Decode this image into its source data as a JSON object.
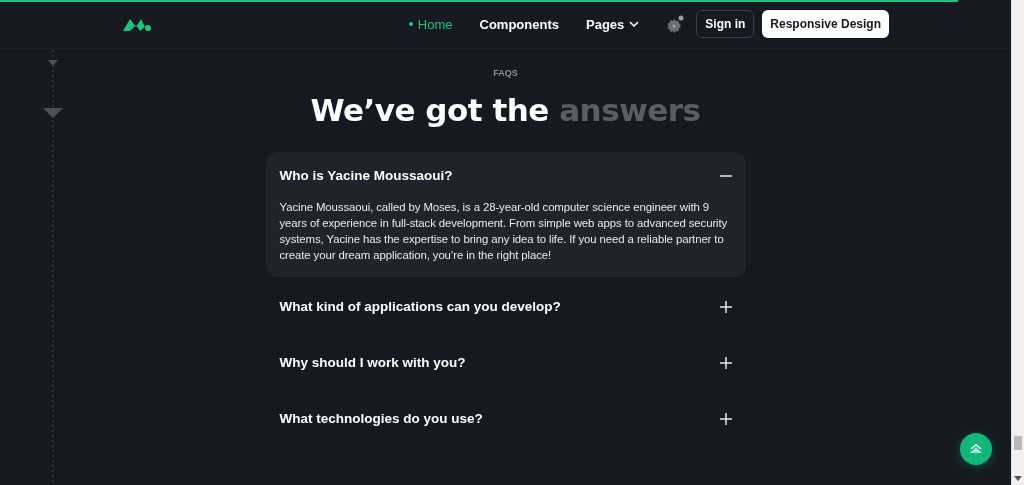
{
  "nav": {
    "links": [
      {
        "label": "Home",
        "selected": true
      },
      {
        "label": "Components",
        "selected": false
      },
      {
        "label": "Pages",
        "selected": false,
        "dropdown": true
      }
    ],
    "sign_in": "Sign in",
    "cta": "Responsive Design"
  },
  "section": {
    "eyebrow": "FAQS",
    "heading": "We’ve got the",
    "heading_highlight": "answers"
  },
  "faqs": [
    {
      "question": "Who is Yacine Moussaoui?",
      "expanded": true,
      "answer": "Yacine Moussaoui, called by Moses, is a 28-year-old computer science engineer with 9 years of experience in full-stack development. From simple web apps to advanced security systems, Yacine has the expertise to bring any idea to life. If you need a reliable partner to create your dream application, you’re in the right place!"
    },
    {
      "question": "What kind of applications can you develop?",
      "expanded": false
    },
    {
      "question": "Why should I work with you?",
      "expanded": false
    },
    {
      "question": "What technologies do you use?",
      "expanded": false
    }
  ]
}
